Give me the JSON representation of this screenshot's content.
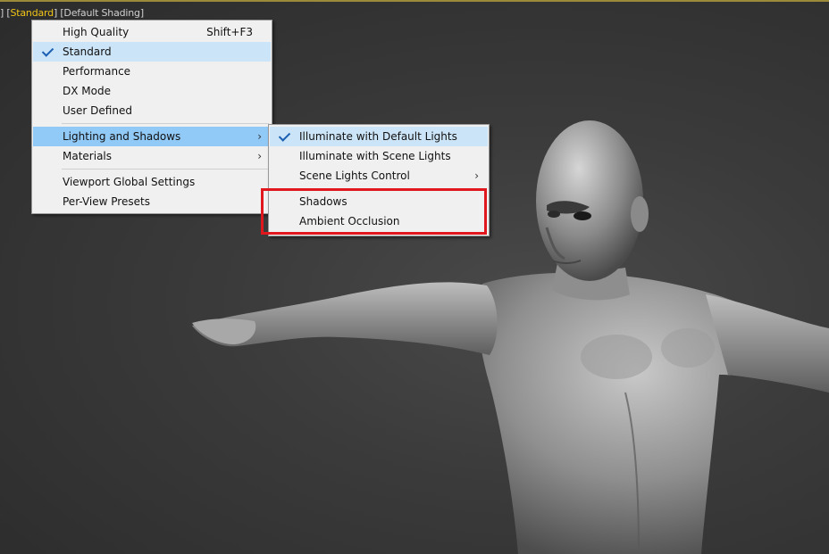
{
  "viewport_label": {
    "prefix": "] [",
    "mode": "Standard",
    "middle": "] [",
    "shading": "Default Shading",
    "suffix": "]"
  },
  "main_menu": {
    "items": [
      {
        "label": "High Quality",
        "shortcut": "Shift+F3"
      },
      {
        "label": "Standard",
        "checked": true
      },
      {
        "label": "Performance"
      },
      {
        "label": "DX Mode"
      },
      {
        "label": "User Defined"
      },
      {
        "label": "Lighting and Shadows",
        "submenu": true,
        "highlighted": true
      },
      {
        "label": "Materials",
        "submenu": true
      },
      {
        "label": "Viewport Global Settings"
      },
      {
        "label": "Per-View Presets"
      }
    ]
  },
  "sub_menu": {
    "items": [
      {
        "label": "Illuminate with Default Lights",
        "checked": true
      },
      {
        "label": "Illuminate with Scene Lights"
      },
      {
        "label": "Scene Lights Control",
        "submenu": true
      },
      {
        "label": "Shadows"
      },
      {
        "label": "Ambient Occlusion"
      }
    ]
  },
  "icons": {
    "submenu_arrow": "chevron-right-icon",
    "check": "check-icon"
  },
  "colors": {
    "highlight_box": "#e0181e",
    "menu_hover": "#91c9f7",
    "active_mode": "#f0c419"
  }
}
